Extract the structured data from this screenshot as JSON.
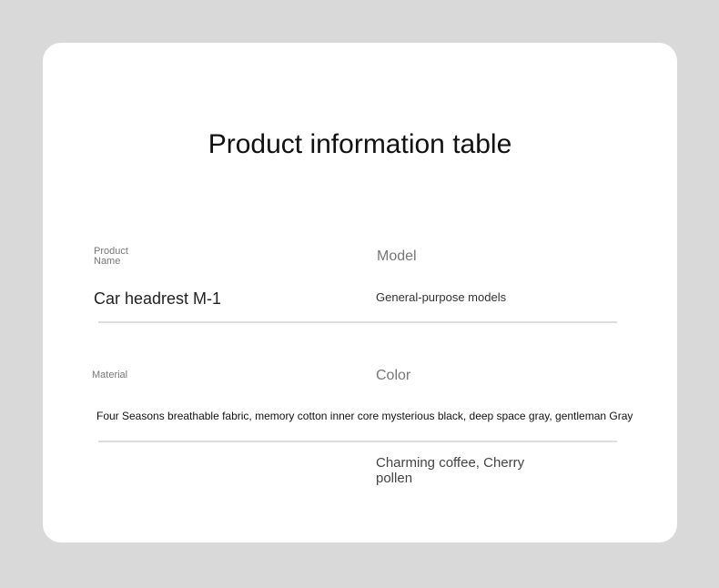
{
  "title": "Product information table",
  "rows": {
    "product_name": {
      "label_line1": "Product",
      "label_line2": "Name",
      "value": "Car headrest M-1"
    },
    "model": {
      "label": "Model",
      "value": "General-purpose models"
    },
    "material": {
      "label": "Material",
      "value": "Four Seasons breathable fabric, memory cotton inner core mysterious black, deep space gray, gentleman Gray"
    },
    "color": {
      "label": "Color",
      "value": "Charming coffee, Cherry pollen"
    }
  },
  "colors": {
    "background": "#d9d9d9",
    "card": "#ffffff",
    "divider": "#dddddd"
  }
}
